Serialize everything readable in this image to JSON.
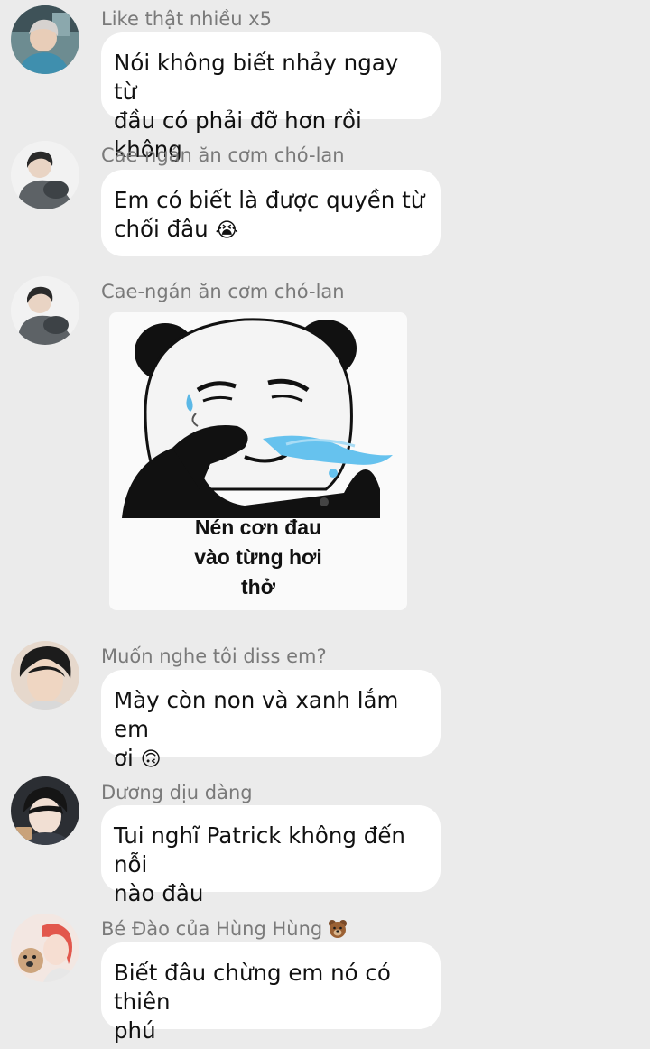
{
  "messages": [
    {
      "sender": "Like thật nhiều x5",
      "lines": [
        "Nói không biết nhảy ngay từ",
        "đầu có phải đỡ hơn rồi không"
      ]
    },
    {
      "sender": "Cae-ngán ăn cơm chó-lan",
      "lines": [
        "Em có biết là được quyền từ",
        "chối đâu"
      ],
      "emoji": "😭"
    },
    {
      "sender": "Cae-ngán ăn cơm chó-lan",
      "sticker_caption": [
        "Nén cơn đau",
        "vào từng hơi",
        "thở"
      ]
    },
    {
      "sender": "Muốn nghe tôi diss em?",
      "lines": [
        "Mày còn non và xanh lắm em",
        "ơi"
      ],
      "emoji": "🙃"
    },
    {
      "sender": "Dương dịu dàng",
      "lines": [
        "Tui nghĩ Patrick không đến nỗi",
        "nào đâu"
      ]
    },
    {
      "sender": "Bé Đào của Hùng Hùng",
      "sender_icon": "bear-face-icon",
      "lines": [
        "Biết đâu chừng em nó có thiên",
        "phú"
      ]
    }
  ],
  "colors": {
    "background": "#ebebeb",
    "bubble": "#ffffff",
    "sender_text": "#7a7a7a",
    "message_text": "#111111"
  }
}
